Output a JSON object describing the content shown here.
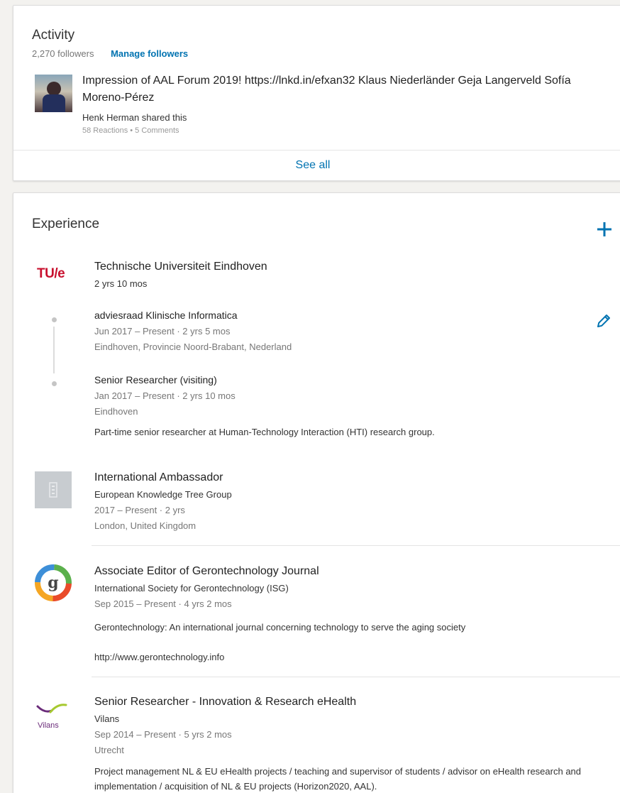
{
  "activity": {
    "title": "Activity",
    "followers": "2,270 followers",
    "manage_followers": "Manage followers",
    "post": {
      "text": "Impression of AAL Forum 2019! https://lnkd.in/efxan32 Klaus Niederländer Geja Langerveld Sofía Moreno-Pérez",
      "shared_by": "Henk Herman shared this",
      "reactions": "58 Reactions • 5 Comments"
    },
    "see_all": "See all"
  },
  "experience": {
    "title": "Experience",
    "entries": [
      {
        "logo_text": "TU/e",
        "company": "Technische Universiteit Eindhoven",
        "duration": "2 yrs 10 mos",
        "roles": [
          {
            "title": "adviesraad Klinische Informatica",
            "dates": "Jun 2017 – Present · 2 yrs 5 mos",
            "location": "Eindhoven, Provincie Noord-Brabant, Nederland"
          },
          {
            "title": "Senior Researcher (visiting)",
            "dates": "Jan 2017 – Present · 2 yrs 10 mos",
            "location": "Eindhoven",
            "description": "Part-time senior researcher at Human-Technology Interaction (HTI) research group."
          }
        ]
      },
      {
        "title": "International Ambassador",
        "company": "European Knowledge Tree Group",
        "dates": "2017 – Present · 2 yrs",
        "location": "London, United Kingdom"
      },
      {
        "title": "Associate Editor of Gerontechnology Journal",
        "company": "International Society for Gerontechnology (ISG)",
        "dates": "Sep 2015 – Present · 4 yrs 2 mos",
        "description": "Gerontechnology: An international journal concerning technology to serve the aging society",
        "link": "http://www.gerontechnology.info"
      },
      {
        "logo_text": "Vilans",
        "title": "Senior Researcher - Innovation & Research eHealth",
        "company": "Vilans",
        "dates": "Sep 2014 – Present · 5 yrs 2 mos",
        "location": "Utrecht",
        "description": "Project management NL & EU eHealth projects / teaching and supervisor of students / advisor on eHealth research and implementation / acquisition of NL & EU projects (Horizon2020, AAL)."
      }
    ]
  },
  "colors": {
    "link": "#0073b1",
    "tue_red": "#c8102e",
    "vilans_purple": "#6b2c7a"
  },
  "icons": {
    "add": "plus-icon",
    "edit": "pencil-icon"
  }
}
